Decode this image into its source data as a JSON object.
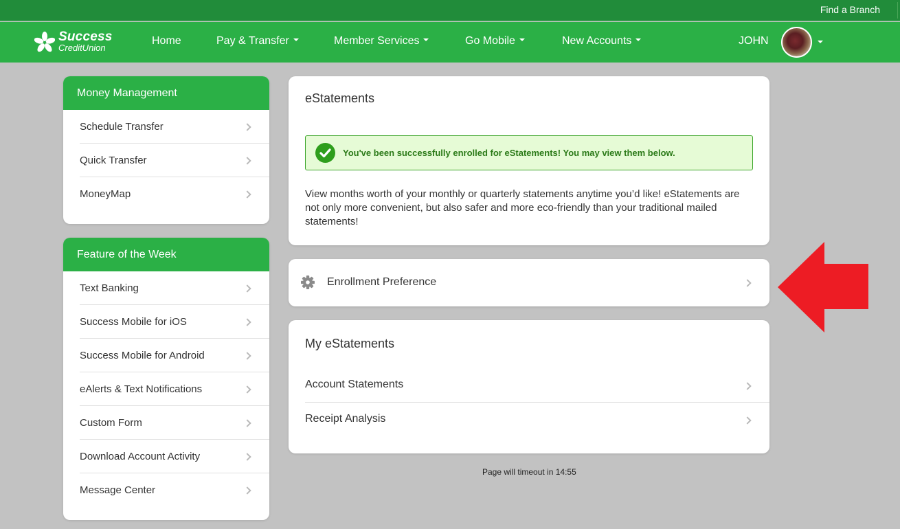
{
  "utility_bar": {
    "find_branch": "Find a Branch"
  },
  "brand": {
    "name_top": "Success",
    "name_bottom": "CreditUnion",
    "primary_color": "#2bb046",
    "dark_color": "#218c3a"
  },
  "nav": {
    "items": [
      {
        "label": "Home",
        "has_dropdown": false
      },
      {
        "label": "Pay & Transfer",
        "has_dropdown": true
      },
      {
        "label": "Member Services",
        "has_dropdown": true
      },
      {
        "label": "Go Mobile",
        "has_dropdown": true
      },
      {
        "label": "New Accounts",
        "has_dropdown": true
      }
    ],
    "user_name": "JOHN"
  },
  "sidebar": {
    "money_management": {
      "title": "Money Management",
      "items": [
        "Schedule Transfer",
        "Quick Transfer",
        "MoneyMap"
      ]
    },
    "feature_of_week": {
      "title": "Feature of the Week",
      "items": [
        "Text Banking",
        "Success Mobile for iOS",
        "Success Mobile for Android",
        "eAlerts & Text Notifications",
        "Custom Form",
        "Download Account Activity",
        "Message Center"
      ]
    }
  },
  "estatements": {
    "title": "eStatements",
    "alert": "You've been successfully enrolled for eStatements! You may view them below.",
    "description": "View months worth of your monthly or quarterly statements anytime you’d like! eStatements are not only more convenient, but also safer and more eco-friendly than your traditional mailed statements!"
  },
  "enrollment_preference": {
    "label": "Enrollment Preference"
  },
  "my_estatements": {
    "title": "My eStatements",
    "items": [
      "Account Statements",
      "Receipt Analysis"
    ]
  },
  "footer": {
    "timeout_text": "Page will timeout in 14:55"
  },
  "annotation": {
    "arrow_color": "#ed1c24"
  }
}
